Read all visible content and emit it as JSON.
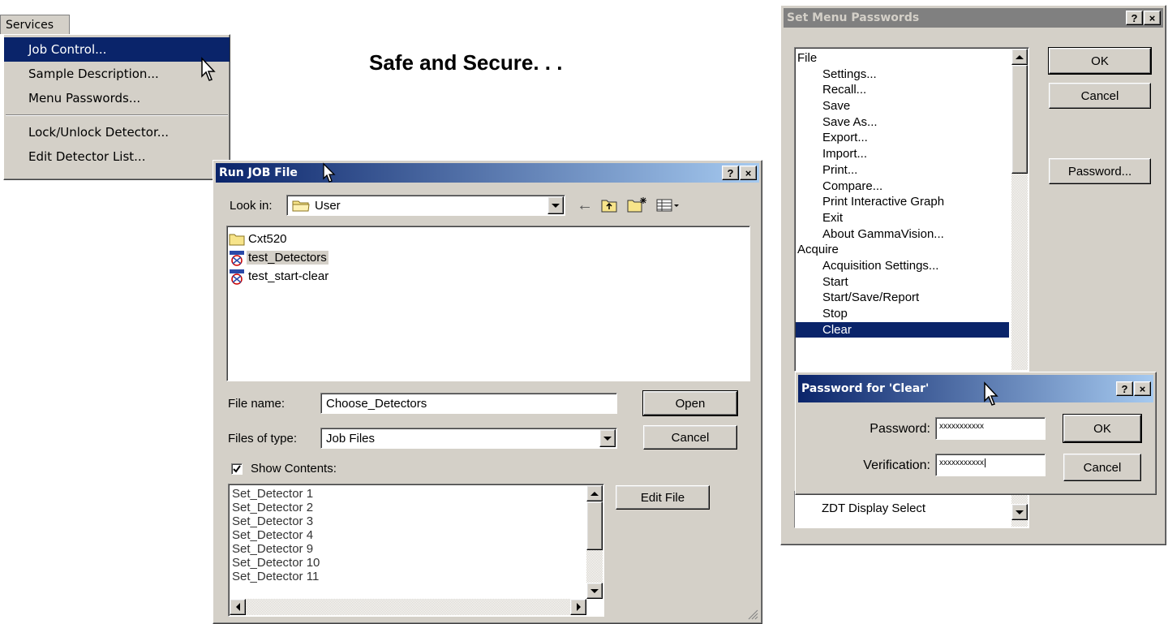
{
  "headline": "Safe and Secure. . .",
  "services_menu": {
    "title": "Services",
    "items": [
      {
        "label": "Job Control...",
        "selected": true
      },
      {
        "label": "Sample Description...",
        "selected": false
      },
      {
        "label": "Menu Passwords...",
        "selected": false
      },
      {
        "label": "Lock/Unlock Detector...",
        "selected": false
      },
      {
        "label": "Edit Detector List...",
        "selected": false
      }
    ]
  },
  "run_job": {
    "title": "Run JOB File",
    "help_label": "?",
    "close_label": "×",
    "look_in_label": "Look in:",
    "look_in_value": "User",
    "files": [
      {
        "name": "Cxt520",
        "icon": "folder-icon"
      },
      {
        "name": "test_Detectors",
        "icon": "job-file-icon",
        "selected": true
      },
      {
        "name": "test_start-clear",
        "icon": "job-file-icon"
      }
    ],
    "file_name_label": "File name:",
    "file_name_value": "Choose_Detectors",
    "files_of_type_label": "Files of type:",
    "files_of_type_value": "Job Files",
    "open_label": "Open",
    "cancel_label": "Cancel",
    "show_contents_label": "Show Contents:",
    "show_contents_checked": true,
    "contents": [
      "Set_Detector 1",
      "Set_Detector 2",
      "Set_Detector 3",
      "Set_Detector 4",
      "Set_Detector 9",
      "Set_Detector 10",
      "Set_Detector 11"
    ],
    "edit_file_label": "Edit File"
  },
  "set_menu_passwords": {
    "title": "Set Menu Passwords",
    "help_label": "?",
    "close_label": "×",
    "ok_label": "OK",
    "cancel_label": "Cancel",
    "password_label": "Password...",
    "tree": [
      {
        "text": "File",
        "level": 0
      },
      {
        "text": "Settings...",
        "level": 1
      },
      {
        "text": "Recall...",
        "level": 1
      },
      {
        "text": "Save",
        "level": 1
      },
      {
        "text": "Save As...",
        "level": 1
      },
      {
        "text": "Export...",
        "level": 1
      },
      {
        "text": "Import...",
        "level": 1
      },
      {
        "text": "Print...",
        "level": 1
      },
      {
        "text": "Compare...",
        "level": 1
      },
      {
        "text": "Print Interactive Graph",
        "level": 1
      },
      {
        "text": "Exit",
        "level": 1
      },
      {
        "text": "About GammaVision...",
        "level": 1
      },
      {
        "text": "Acquire",
        "level": 0
      },
      {
        "text": "Acquisition Settings...",
        "level": 1
      },
      {
        "text": "Start",
        "level": 1
      },
      {
        "text": "Start/Save/Report",
        "level": 1
      },
      {
        "text": "Stop",
        "level": 1
      },
      {
        "text": "Clear",
        "level": 1,
        "selected": true
      }
    ],
    "bottom_item": "ZDT Display Select"
  },
  "password_dialog": {
    "title": "Password for 'Clear'",
    "help_label": "?",
    "close_label": "×",
    "password_label": "Password:",
    "password_value": "xxxxxxxxxxx",
    "verification_label": "Verification:",
    "verification_value": "xxxxxxxxxxx",
    "ok_label": "OK",
    "cancel_label": "Cancel"
  },
  "colors": {
    "title_active_start": "#0a246a",
    "title_active_end": "#a6caf0",
    "title_inactive": "#808080",
    "face": "#d4d0c8",
    "selection": "#0a246a"
  }
}
